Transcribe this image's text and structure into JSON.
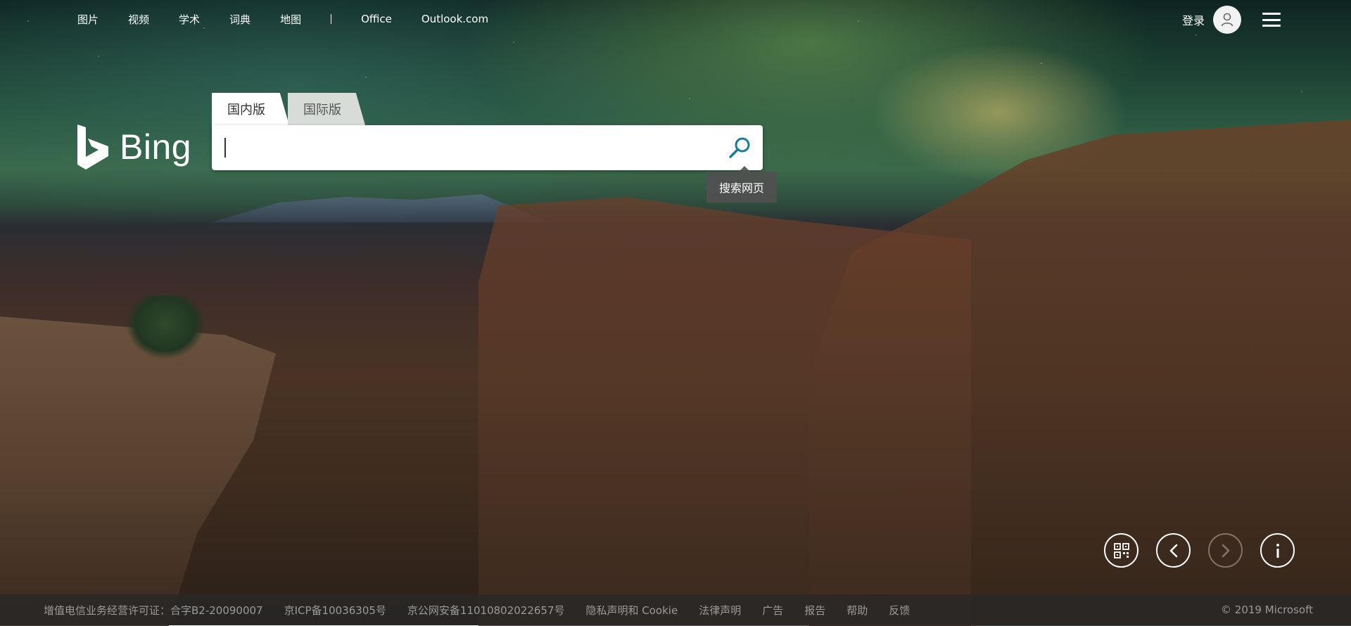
{
  "nav": {
    "links": [
      "图片",
      "视频",
      "学术",
      "词典",
      "地图"
    ],
    "links_after_sep": [
      "Office",
      "Outlook.com"
    ]
  },
  "account": {
    "signin_label": "登录",
    "avatar_icon": "user-icon",
    "menu_icon": "hamburger-menu-icon"
  },
  "logo": {
    "text": "Bing",
    "icon": "bing-b-logo"
  },
  "search": {
    "tabs": [
      {
        "label": "国内版",
        "active": true
      },
      {
        "label": "国际版",
        "active": false
      }
    ],
    "value": "",
    "button_icon": "search-icon",
    "tooltip": "搜索网页"
  },
  "image_controls": [
    {
      "name": "qr-code-button",
      "icon": "qr-code-icon",
      "enabled": true
    },
    {
      "name": "previous-image-button",
      "icon": "chevron-left-icon",
      "enabled": true
    },
    {
      "name": "next-image-button",
      "icon": "chevron-right-icon",
      "enabled": false
    },
    {
      "name": "image-info-button",
      "icon": "info-icon",
      "enabled": true
    }
  ],
  "footer": {
    "links": [
      "增值电信业务经营许可证：合字B2-20090007",
      "京ICP备10036305号",
      "京公网安备11010802022657号",
      "隐私声明和 Cookie",
      "法律声明",
      "广告",
      "报告",
      "帮助",
      "反馈"
    ],
    "copyright": "© 2019 Microsoft"
  },
  "colors": {
    "search_icon": "#1b7c9a",
    "footer_bg": "#282828",
    "tab_inactive": "#d7dcd9"
  }
}
